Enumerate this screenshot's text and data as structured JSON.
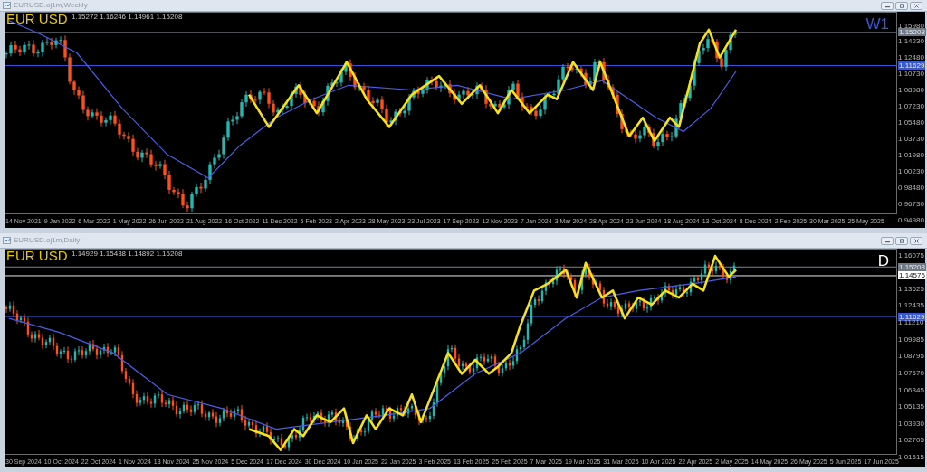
{
  "windows": [
    {
      "title": "EURUSD.oj1m,Weekly",
      "symbol_label": "EUR USD",
      "ohlc": "1.15272 1.16246 1.14961 1.15208",
      "timeframe": {
        "text": "W1",
        "color": "#3559d6"
      },
      "price_labels": [
        {
          "text": "1.15980",
          "kind": "tick"
        },
        {
          "text": "1.15208",
          "kind": "bid"
        },
        {
          "text": "1.14230",
          "kind": "tick"
        },
        {
          "text": "1.12480",
          "kind": "tick"
        },
        {
          "text": "1.11629",
          "kind": "level"
        },
        {
          "text": "1.10730",
          "kind": "tick"
        },
        {
          "text": "1.08980",
          "kind": "tick"
        },
        {
          "text": "1.07230",
          "kind": "tick"
        },
        {
          "text": "1.05480",
          "kind": "tick"
        },
        {
          "text": "1.03730",
          "kind": "tick"
        },
        {
          "text": "1.01980",
          "kind": "tick"
        },
        {
          "text": "1.00230",
          "kind": "tick"
        },
        {
          "text": "0.98480",
          "kind": "tick"
        },
        {
          "text": "0.96730",
          "kind": "tick"
        },
        {
          "text": "0.94980",
          "kind": "tick"
        }
      ],
      "time_labels": [
        "14 Nov 2021",
        "9 Jan 2022",
        "6 Mar 2022",
        "1 May 2022",
        "26 Jun 2022",
        "21 Aug 2022",
        "16 Oct 2022",
        "11 Dec 2022",
        "5 Feb 2023",
        "2 Apr 2023",
        "28 May 2023",
        "23 Jul 2023",
        "17 Sep 2023",
        "12 Nov 2023",
        "7 Jan 2024",
        "3 Mar 2024",
        "28 Apr 2024",
        "23 Jun 2024",
        "18 Aug 2024",
        "13 Oct 2024",
        "8 Dec 2024",
        "2 Feb 2025",
        "30 Mar 2025",
        "25 May 2025"
      ]
    },
    {
      "title": "EURUSD.oj1m,Daily",
      "symbol_label": "EUR USD",
      "ohlc": "1.14929 1.15438 1.14892 1.15208",
      "timeframe": {
        "text": "D",
        "color": "#ffffff"
      },
      "price_labels": [
        {
          "text": "1.16075",
          "kind": "tick"
        },
        {
          "text": "1.15208",
          "kind": "bid"
        },
        {
          "text": "1.14576",
          "kind": "line"
        },
        {
          "text": "1.13625",
          "kind": "tick"
        },
        {
          "text": "1.12435",
          "kind": "tick"
        },
        {
          "text": "1.11629",
          "kind": "level"
        },
        {
          "text": "1.11210",
          "kind": "tick"
        },
        {
          "text": "1.09985",
          "kind": "tick"
        },
        {
          "text": "1.08795",
          "kind": "tick"
        },
        {
          "text": "1.07570",
          "kind": "tick"
        },
        {
          "text": "1.06345",
          "kind": "tick"
        },
        {
          "text": "1.05135",
          "kind": "tick"
        },
        {
          "text": "1.03930",
          "kind": "tick"
        },
        {
          "text": "1.02705",
          "kind": "tick"
        },
        {
          "text": "1.01515",
          "kind": "tick"
        }
      ],
      "time_labels": [
        "30 Sep 2024",
        "10 Oct 2024",
        "22 Oct 2024",
        "1 Nov 2024",
        "13 Nov 2024",
        "25 Nov 2024",
        "5 Dec 2024",
        "17 Dec 2024",
        "30 Dec 2024",
        "10 Jan 2025",
        "22 Jan 2025",
        "3 Feb 2025",
        "13 Feb 2025",
        "25 Feb 2025",
        "7 Mar 2025",
        "19 Mar 2025",
        "31 Mar 2025",
        "10 Apr 2025",
        "22 Apr 2025",
        "2 May 2025",
        "14 May 2025",
        "26 May 2025",
        "5 Jun 2025",
        "17 Jun 2025"
      ]
    }
  ]
}
